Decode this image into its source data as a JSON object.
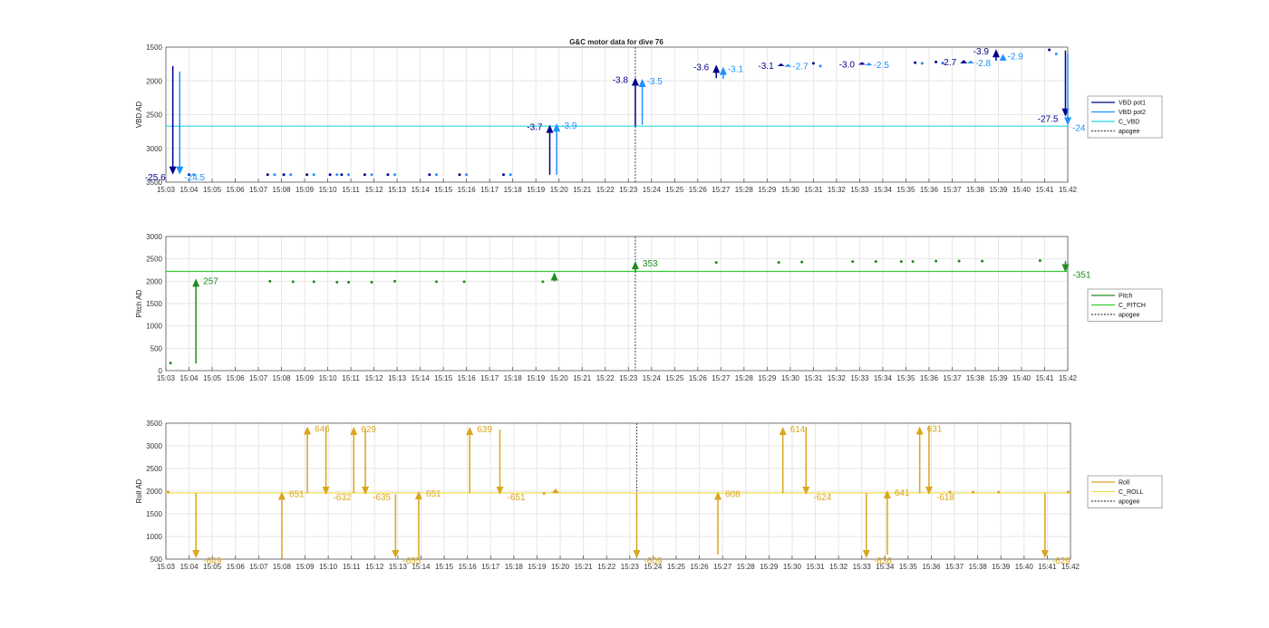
{
  "figure_title": "G&C motor data for dive 76",
  "colors": {
    "vbd1": "#00008b",
    "vbd2": "#1e90ff",
    "c_vbd": "#28d7e6",
    "pitch": "#228b22",
    "c_pitch": "#32cd32",
    "roll": "#daa520",
    "c_roll": "#f0e050",
    "apogee": "#444444",
    "grid": "#e6e6e6",
    "axis": "#555555"
  },
  "time_ticks": [
    "15:03",
    "15:04",
    "15:05",
    "15:06",
    "15:07",
    "15:08",
    "15:09",
    "15:10",
    "15:11",
    "15:12",
    "15:13",
    "15:14",
    "15:15",
    "15:16",
    "15:17",
    "15:18",
    "15:19",
    "15:20",
    "15:21",
    "15:22",
    "15:23",
    "15:24",
    "15:25",
    "15:26",
    "15:27",
    "15:28",
    "15:29",
    "15:30",
    "15:31",
    "15:32",
    "15:33",
    "15:34",
    "15:35",
    "15:36",
    "15:37",
    "15:38",
    "15:39",
    "15:40",
    "15:41",
    "15:42"
  ],
  "chart_data": [
    {
      "type": "line",
      "ylabel": "VBD AD",
      "ylim": [
        1500,
        3500
      ],
      "y_reversed": true,
      "yticks": [
        1500,
        2000,
        2500,
        3000,
        3500
      ],
      "x_unit": "minutes after 15:03",
      "xlim": [
        0,
        39
      ],
      "grid": true,
      "legend_position": "right",
      "legend": [
        "VBD pot1",
        "VBD pot2",
        "C_VBD",
        "apogee"
      ],
      "apogee_x": 20.3,
      "reference_line": {
        "name": "C_VBD",
        "value": 2670
      },
      "arrows": [
        {
          "series": "VBD pot1",
          "x": 0.3,
          "y_start": 1780,
          "y_end": 3390,
          "label": "-25.6"
        },
        {
          "series": "VBD pot2",
          "x": 0.6,
          "y_start": 1860,
          "y_end": 3390,
          "label": "-24.5"
        },
        {
          "series": "VBD pot1",
          "x": 16.6,
          "y_start": 3390,
          "y_end": 2650,
          "label": "-3.7"
        },
        {
          "series": "VBD pot2",
          "x": 16.9,
          "y_start": 3390,
          "y_end": 2630,
          "label": "-3.9"
        },
        {
          "series": "VBD pot1",
          "x": 20.3,
          "y_start": 2670,
          "y_end": 1950,
          "label": "-3.8"
        },
        {
          "series": "VBD pot2",
          "x": 20.6,
          "y_start": 2650,
          "y_end": 1970,
          "label": "-3.5"
        },
        {
          "series": "VBD pot1",
          "x": 23.8,
          "y_start": 1960,
          "y_end": 1760,
          "label": "-3.6"
        },
        {
          "series": "VBD pot2",
          "x": 24.1,
          "y_start": 1970,
          "y_end": 1790,
          "label": "-3.1"
        },
        {
          "series": "VBD pot1",
          "x": 26.6,
          "y_start": 1780,
          "y_end": 1740,
          "label": "-3.1"
        },
        {
          "series": "VBD pot2",
          "x": 26.9,
          "y_start": 1790,
          "y_end": 1750,
          "label": "-2.7"
        },
        {
          "series": "VBD pot1",
          "x": 30.1,
          "y_start": 1760,
          "y_end": 1720,
          "label": "-3.0"
        },
        {
          "series": "VBD pot2",
          "x": 30.4,
          "y_start": 1770,
          "y_end": 1730,
          "label": "-2.5"
        },
        {
          "series": "VBD pot1",
          "x": 34.5,
          "y_start": 1740,
          "y_end": 1690,
          "label": "-2.7"
        },
        {
          "series": "VBD pot2",
          "x": 34.8,
          "y_start": 1740,
          "y_end": 1700,
          "label": "-2.8"
        },
        {
          "series": "VBD pot1",
          "x": 35.9,
          "y_start": 1700,
          "y_end": 1530,
          "label": "-3.9"
        },
        {
          "series": "VBD pot2",
          "x": 36.2,
          "y_start": 1700,
          "y_end": 1600,
          "label": "-2.9"
        },
        {
          "series": "VBD pot1",
          "x": 38.9,
          "y_start": 1550,
          "y_end": 2530,
          "label": "-27.5"
        },
        {
          "series": "VBD pot2",
          "x": 39.0,
          "y_start": 1600,
          "y_end": 2660,
          "label": "-24"
        }
      ],
      "points": {
        "VBD pot1": [
          [
            1,
            3390
          ],
          [
            4.4,
            3390
          ],
          [
            5.1,
            3390
          ],
          [
            6.1,
            3390
          ],
          [
            7.1,
            3390
          ],
          [
            7.6,
            3390
          ],
          [
            8.6,
            3390
          ],
          [
            9.6,
            3390
          ],
          [
            11.4,
            3390
          ],
          [
            12.7,
            3390
          ],
          [
            14.6,
            3390
          ],
          [
            28,
            1740
          ],
          [
            32.4,
            1730
          ],
          [
            33.3,
            1720
          ],
          [
            38.2,
            1540
          ]
        ],
        "VBD pot2": [
          [
            1.2,
            3390
          ],
          [
            4.7,
            3390
          ],
          [
            5.4,
            3390
          ],
          [
            6.4,
            3390
          ],
          [
            7.4,
            3390
          ],
          [
            7.9,
            3390
          ],
          [
            8.9,
            3390
          ],
          [
            9.9,
            3390
          ],
          [
            11.7,
            3390
          ],
          [
            13,
            3390
          ],
          [
            14.9,
            3390
          ],
          [
            28.3,
            1780
          ],
          [
            32.7,
            1740
          ],
          [
            33.6,
            1740
          ],
          [
            38.5,
            1600
          ]
        ]
      }
    },
    {
      "type": "line",
      "ylabel": "Pitch AD",
      "ylim": [
        0,
        3000
      ],
      "yticks": [
        0,
        500,
        1000,
        1500,
        2000,
        2500,
        3000
      ],
      "x_unit": "minutes after 15:03",
      "xlim": [
        0,
        39
      ],
      "grid": true,
      "legend_position": "right",
      "legend": [
        "Pitch",
        "C_PITCH",
        "apogee"
      ],
      "apogee_x": 20.3,
      "reference_line": {
        "name": "C_PITCH",
        "value": 2220
      },
      "arrows": [
        {
          "series": "Pitch",
          "x": 1.3,
          "y_start": 160,
          "y_end": 2060,
          "label": "257"
        },
        {
          "series": "Pitch",
          "x": 16.8,
          "y_start": 2000,
          "y_end": 2200,
          "label": ""
        },
        {
          "series": "Pitch",
          "x": 20.3,
          "y_start": 2220,
          "y_end": 2450,
          "label": "353"
        },
        {
          "series": "Pitch",
          "x": 38.9,
          "y_start": 2450,
          "y_end": 2200,
          "label": "-351"
        }
      ],
      "points": {
        "Pitch": [
          [
            0.2,
            170
          ],
          [
            4.5,
            2000
          ],
          [
            5.5,
            1990
          ],
          [
            6.4,
            1990
          ],
          [
            7.4,
            1980
          ],
          [
            7.9,
            1980
          ],
          [
            8.9,
            1980
          ],
          [
            9.9,
            2000
          ],
          [
            11.7,
            1990
          ],
          [
            12.9,
            1990
          ],
          [
            16.3,
            1990
          ],
          [
            23.8,
            2420
          ],
          [
            26.5,
            2420
          ],
          [
            27.5,
            2430
          ],
          [
            29.7,
            2440
          ],
          [
            30.7,
            2440
          ],
          [
            31.8,
            2440
          ],
          [
            32.3,
            2440
          ],
          [
            33.3,
            2450
          ],
          [
            34.3,
            2450
          ],
          [
            35.3,
            2450
          ],
          [
            37.8,
            2460
          ]
        ]
      }
    },
    {
      "type": "line",
      "ylabel": "Roll AD",
      "ylim": [
        500,
        3500
      ],
      "yticks": [
        500,
        1000,
        1500,
        2000,
        2500,
        3000,
        3500
      ],
      "x_unit": "minutes after 15:03",
      "xlim": [
        0,
        39
      ],
      "grid": true,
      "legend_position": "right",
      "legend": [
        "Roll",
        "C_ROLL",
        "apogee"
      ],
      "apogee_x": 20.3,
      "reference_line": {
        "name": "C_ROLL",
        "value": 1960
      },
      "arrows": [
        {
          "series": "Roll",
          "x": 1.3,
          "y_start": 1960,
          "y_end": 520,
          "label": "-649"
        },
        {
          "series": "Roll",
          "x": 5,
          "y_start": 520,
          "y_end": 1990,
          "label": "651"
        },
        {
          "series": "Roll",
          "x": 6.1,
          "y_start": 1960,
          "y_end": 3430,
          "label": "646"
        },
        {
          "series": "Roll",
          "x": 6.9,
          "y_start": 3430,
          "y_end": 1920,
          "label": "-632"
        },
        {
          "series": "Roll",
          "x": 8.1,
          "y_start": 1960,
          "y_end": 3420,
          "label": "629"
        },
        {
          "series": "Roll",
          "x": 8.6,
          "y_start": 3390,
          "y_end": 1920,
          "label": "-635"
        },
        {
          "series": "Roll",
          "x": 9.9,
          "y_start": 1930,
          "y_end": 520,
          "label": "-655"
        },
        {
          "series": "Roll",
          "x": 10.9,
          "y_start": 520,
          "y_end": 2000,
          "label": "651"
        },
        {
          "series": "Roll",
          "x": 13.1,
          "y_start": 1960,
          "y_end": 3420,
          "label": "639"
        },
        {
          "series": "Roll",
          "x": 14.4,
          "y_start": 3360,
          "y_end": 1920,
          "label": "-651"
        },
        {
          "series": "Roll",
          "x": 16.8,
          "y_start": 1960,
          "y_end": 2060,
          "label": ""
        },
        {
          "series": "Roll",
          "x": 20.3,
          "y_start": 1960,
          "y_end": 520,
          "label": "-609"
        },
        {
          "series": "Roll",
          "x": 23.8,
          "y_start": 600,
          "y_end": 1990,
          "label": "608"
        },
        {
          "series": "Roll",
          "x": 26.6,
          "y_start": 1960,
          "y_end": 3420,
          "label": "614"
        },
        {
          "series": "Roll",
          "x": 27.6,
          "y_start": 3420,
          "y_end": 1920,
          "label": "-624"
        },
        {
          "series": "Roll",
          "x": 30.2,
          "y_start": 1960,
          "y_end": 520,
          "label": "-636"
        },
        {
          "series": "Roll",
          "x": 31.1,
          "y_start": 600,
          "y_end": 2020,
          "label": "641"
        },
        {
          "series": "Roll",
          "x": 32.5,
          "y_start": 1960,
          "y_end": 3430,
          "label": "631"
        },
        {
          "series": "Roll",
          "x": 32.9,
          "y_start": 3430,
          "y_end": 1920,
          "label": "-618"
        },
        {
          "series": "Roll",
          "x": 37.9,
          "y_start": 1960,
          "y_end": 520,
          "label": "-629"
        }
      ],
      "points": {
        "Roll": [
          [
            0.1,
            1980
          ],
          [
            16.3,
            1950
          ],
          [
            33.8,
            1980
          ],
          [
            34.8,
            1980
          ],
          [
            35.9,
            1980
          ],
          [
            38.9,
            1980
          ]
        ]
      }
    }
  ]
}
